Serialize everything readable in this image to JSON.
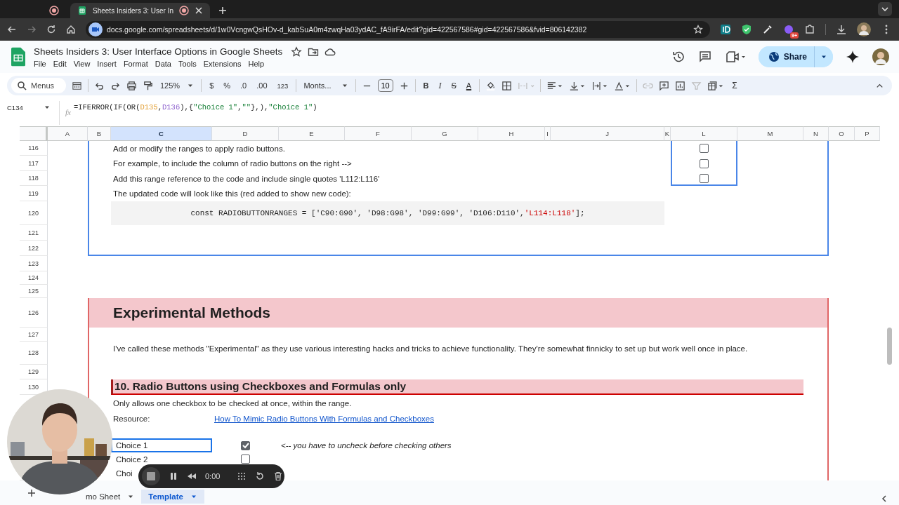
{
  "browser": {
    "tabs": [
      {
        "kind": "recording",
        "selected": false
      },
      {
        "kind": "page",
        "title": "Sheets Insiders 3: User In",
        "selected": true
      }
    ],
    "url": "docs.google.com/spreadsheets/d/1w0VcngwQsHOv-d_kabSuA0m4zwqHa03ydAC_fA9irFA/edit?gid=422567586#gid=422567586&fvid=806142382",
    "extension_badge": "9+"
  },
  "document": {
    "title": "Sheets Insiders 3: User Interface Options in Google Sheets",
    "menus": [
      "File",
      "Edit",
      "View",
      "Insert",
      "Format",
      "Data",
      "Tools",
      "Extensions",
      "Help"
    ],
    "share_label": "Share"
  },
  "toolbar": {
    "search_placeholder": "Menus",
    "zoom": "125%",
    "currency": "$",
    "percent": "%",
    "decrease_decimals": ".0",
    "increase_decimals": ".00",
    "number_format": "123",
    "font": "Monts...",
    "font_size": "10",
    "text_format": [
      {
        "kind": "bold",
        "label": "B"
      },
      {
        "kind": "italic",
        "label": "I"
      },
      {
        "kind": "strikethrough",
        "label": "S"
      },
      {
        "kind": "color",
        "label": "A"
      }
    ],
    "sum": "Σ"
  },
  "formula_bar": {
    "cell": "C134",
    "fx": "fx",
    "formula": [
      {
        "kind": "plain",
        "text": "=IFERROR(IF(OR("
      },
      {
        "kind": "ref",
        "text": "D135",
        "color": "#e3a23a"
      },
      {
        "kind": "plain",
        "text": ","
      },
      {
        "kind": "ref",
        "text": "D136",
        "color": "#8e63ce"
      },
      {
        "kind": "plain",
        "text": "),{"
      },
      {
        "kind": "string",
        "text": "\"Choice 1\""
      },
      {
        "kind": "plain",
        "text": ","
      },
      {
        "kind": "string",
        "text": "\"\""
      },
      {
        "kind": "plain",
        "text": "},),"
      },
      {
        "kind": "string",
        "text": "\"Choice 1\""
      },
      {
        "kind": "plain",
        "text": ")"
      }
    ]
  },
  "columns": [
    {
      "label": "A",
      "selected": false
    },
    {
      "label": "B",
      "selected": false
    },
    {
      "label": "C",
      "selected": true
    },
    {
      "label": "D",
      "selected": false
    },
    {
      "label": "E",
      "selected": false
    },
    {
      "label": "F",
      "selected": false
    },
    {
      "label": "G",
      "selected": false
    },
    {
      "label": "H",
      "selected": false
    },
    {
      "label": "I",
      "selected": false
    },
    {
      "label": "J",
      "selected": false
    },
    {
      "label": "K",
      "selected": false
    },
    {
      "label": "L",
      "selected": false
    },
    {
      "label": "M",
      "selected": false
    },
    {
      "label": "N",
      "selected": false
    },
    {
      "label": "O",
      "selected": false
    },
    {
      "label": "P",
      "selected": false
    }
  ],
  "rows": [
    "116",
    "117",
    "118",
    "119",
    "120",
    "121",
    "122",
    "123",
    "124",
    "125",
    "126",
    "127",
    "128",
    "129",
    "130"
  ],
  "instructions": [
    "Add or modify the ranges to apply radio buttons.",
    "For example, to include the column of radio buttons on the right -->",
    "Add this range reference to the code and include single quotes 'L112:L116'",
    "The updated code will look like this (red added to show new code):"
  ],
  "code_line": [
    {
      "kind": "plain",
      "text": "const RADIOBUTTONRANGES = ['C90:G90', 'D98:G98', 'D99:G99', 'D106:D110',"
    },
    {
      "kind": "added",
      "text": "'L114:L118'"
    },
    {
      "kind": "plain",
      "text": "];"
    }
  ],
  "radio_checkboxes": [
    {
      "checked": false
    },
    {
      "checked": false
    },
    {
      "checked": false
    }
  ],
  "section": {
    "title": "Experimental Methods",
    "description": "I've called these methods \"Experimental\" as they use various interesting hacks and tricks to achieve functionality. They're somewhat finnicky to set up but work well once in place."
  },
  "subsection": {
    "title": "10. Radio Buttons using Checkboxes and Formulas only",
    "note": "Only allows one checkbox to be checked at once, within the range.",
    "resource_label": "Resource:",
    "resource_link": "How To Mimic Radio Buttons With Formulas and Checkboxes",
    "choices": [
      {
        "label": "Choice 1",
        "selected": true,
        "checked": true
      },
      {
        "label": "Choice 2",
        "selected": false,
        "checked": false
      },
      {
        "label": "Choi",
        "selected": false
      }
    ],
    "choice_note": "<-- you have to uncheck before checking others"
  },
  "sheet_tabs": [
    {
      "label": "mo Sheet",
      "selected": false
    },
    {
      "label": "Template",
      "selected": true
    }
  ],
  "recorder": {
    "time": "0:00"
  }
}
